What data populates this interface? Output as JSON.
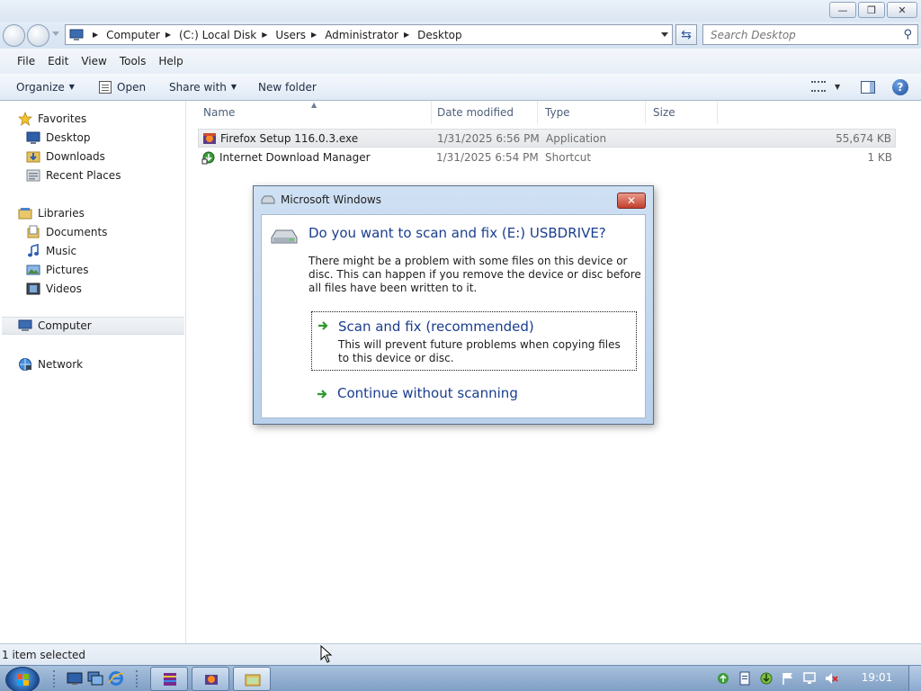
{
  "window": {
    "controls": [
      "minimize",
      "maximize",
      "close"
    ]
  },
  "address": {
    "crumbs": [
      "Computer",
      "(C:) Local Disk",
      "Users",
      "Administrator",
      "Desktop"
    ],
    "search_placeholder": "Search Desktop"
  },
  "menu": [
    "File",
    "Edit",
    "View",
    "Tools",
    "Help"
  ],
  "commands": {
    "organize": "Organize",
    "open": "Open",
    "share_with": "Share with",
    "new_folder": "New folder"
  },
  "nav": {
    "favorites": "Favorites",
    "desktop": "Desktop",
    "downloads": "Downloads",
    "recent_places": "Recent Places",
    "libraries": "Libraries",
    "documents": "Documents",
    "music": "Music",
    "pictures": "Pictures",
    "videos": "Videos",
    "computer": "Computer",
    "network": "Network"
  },
  "columns": {
    "name": "Name",
    "date": "Date modified",
    "type": "Type",
    "size": "Size"
  },
  "files": [
    {
      "name": "Firefox Setup 116.0.3.exe",
      "date": "1/31/2025 6:56 PM",
      "type": "Application",
      "size": "55,674 KB",
      "icon": "firefox-installer-icon",
      "selected": true
    },
    {
      "name": "Internet Download Manager",
      "date": "1/31/2025 6:54 PM",
      "type": "Shortcut",
      "size": "1 KB",
      "icon": "idm-shortcut-icon",
      "selected": false
    }
  ],
  "status": "1 item selected",
  "dialog": {
    "title": "Microsoft Windows",
    "heading": "Do you want to scan and fix (E:) USBDRIVE?",
    "description": "There might be a problem with some files on this device or disc. This can happen if you remove the device or disc before all files have been written to it.",
    "option_primary": "Scan and fix (recommended)",
    "option_primary_sub": "This will prevent future problems when copying files to this device or disc.",
    "option_secondary": "Continue without scanning"
  },
  "taskbar": {
    "clock": "19:01"
  },
  "colors": {
    "link_blue": "#1a3e8e",
    "close_red": "#c1402b",
    "taskbar": "#8fabcf"
  }
}
